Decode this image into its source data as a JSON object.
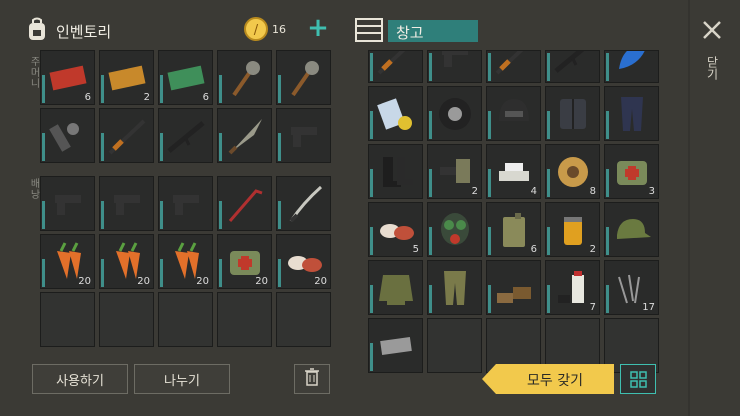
{
  "inventory": {
    "title": "인벤토리",
    "coins": "16",
    "side_labels": [
      "주머니",
      "배낭"
    ],
    "slots": [
      {
        "icon": "coupon-red-icon",
        "count": "6"
      },
      {
        "icon": "coupon-orange-icon",
        "count": "2"
      },
      {
        "icon": "coupon-green-icon",
        "count": "6"
      },
      {
        "icon": "spiked-club-icon",
        "count": ""
      },
      {
        "icon": "spiked-club-icon",
        "count": ""
      },
      {
        "icon": "chainsaw-icon",
        "count": ""
      },
      {
        "icon": "rifle-icon",
        "count": ""
      },
      {
        "icon": "assault-rifle-icon",
        "count": ""
      },
      {
        "icon": "machete-icon",
        "count": ""
      },
      {
        "icon": "pistol-icon",
        "count": ""
      },
      {
        "icon": "pistol-icon",
        "count": ""
      },
      {
        "icon": "pistol-icon",
        "count": ""
      },
      {
        "icon": "pistol-icon",
        "count": ""
      },
      {
        "icon": "crowbar-icon",
        "count": ""
      },
      {
        "icon": "katana-icon",
        "count": ""
      },
      {
        "icon": "carrot-icon",
        "count": "20"
      },
      {
        "icon": "carrot-icon",
        "count": "20"
      },
      {
        "icon": "carrot-icon",
        "count": "20"
      },
      {
        "icon": "medkit-bag-icon",
        "count": "20"
      },
      {
        "icon": "meat-icon",
        "count": "20"
      },
      {
        "icon": "",
        "count": ""
      },
      {
        "icon": "",
        "count": ""
      },
      {
        "icon": "",
        "count": ""
      },
      {
        "icon": "",
        "count": ""
      },
      {
        "icon": "",
        "count": ""
      }
    ],
    "use_button": "사용하기",
    "split_button": "나누기"
  },
  "storage": {
    "title": "창고",
    "take_all_button": "모두 갖기",
    "close_label": "닫기",
    "slots": [
      {
        "icon": "rifle-icon",
        "count": ""
      },
      {
        "icon": "pistol-icon",
        "count": ""
      },
      {
        "icon": "rifle-icon",
        "count": ""
      },
      {
        "icon": "assault-rifle-icon",
        "count": ""
      },
      {
        "icon": "blue-fuel-icon",
        "count": ""
      },
      {
        "icon": "map-roll-icon",
        "count": ""
      },
      {
        "icon": "tire-icon",
        "count": ""
      },
      {
        "icon": "helmet-icon",
        "count": ""
      },
      {
        "icon": "vest-icon",
        "count": ""
      },
      {
        "icon": "pants-icon",
        "count": ""
      },
      {
        "icon": "boots-icon",
        "count": ""
      },
      {
        "icon": "gun-parts-icon",
        "count": "2"
      },
      {
        "icon": "silver-bars-icon",
        "count": "4"
      },
      {
        "icon": "wire-spool-icon",
        "count": "8"
      },
      {
        "icon": "medkit-bag-icon",
        "count": "3"
      },
      {
        "icon": "meat-icon",
        "count": "5"
      },
      {
        "icon": "gas-mask-icon",
        "count": ""
      },
      {
        "icon": "jerrycan-icon",
        "count": "6"
      },
      {
        "icon": "oil-filter-icon",
        "count": "2"
      },
      {
        "icon": "camo-cap-icon",
        "count": ""
      },
      {
        "icon": "camo-jacket-icon",
        "count": ""
      },
      {
        "icon": "camo-pants-icon",
        "count": ""
      },
      {
        "icon": "camo-shoes-icon",
        "count": ""
      },
      {
        "icon": "spray-can-icon",
        "count": "7"
      },
      {
        "icon": "nails-icon",
        "count": "17"
      },
      {
        "icon": "metal-plate-icon",
        "count": ""
      },
      {
        "icon": "",
        "count": ""
      },
      {
        "icon": "",
        "count": ""
      },
      {
        "icon": "",
        "count": ""
      },
      {
        "icon": "",
        "count": ""
      }
    ]
  },
  "colors": {
    "accent": "#3f8f8a",
    "gold": "#f2c94c",
    "teal_header": "#2f7f7a"
  }
}
